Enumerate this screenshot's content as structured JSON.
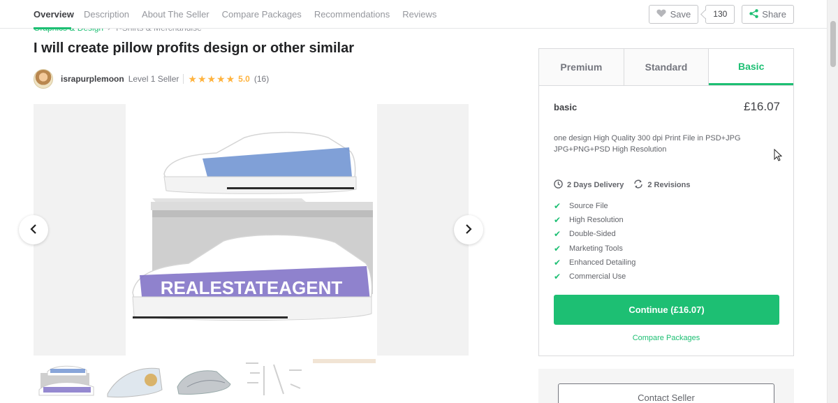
{
  "nav": {
    "tabs": [
      {
        "label": "Overview"
      },
      {
        "label": "Description"
      },
      {
        "label": "About The Seller"
      },
      {
        "label": "Compare Packages"
      },
      {
        "label": "Recommendations"
      },
      {
        "label": "Reviews"
      }
    ],
    "save_label": "Save",
    "save_count": "130",
    "share_label": "Share"
  },
  "breadcrumb": {
    "crumb1": "Graphics & Design",
    "crumb2": "T-Shirts & Merchandise"
  },
  "gig": {
    "title": "I will create pillow profits design or other similar"
  },
  "seller": {
    "name": "israpurplemoon",
    "level": "Level 1 Seller",
    "stars": "★★★★★",
    "rating": "5.0",
    "reviews": "(16)"
  },
  "product_art": {
    "text": "REALESTATEAGENT"
  },
  "package": {
    "tabs": [
      {
        "label": "Premium"
      },
      {
        "label": "Standard"
      },
      {
        "label": "Basic"
      }
    ],
    "name": "basic",
    "price": "£16.07",
    "description": "one design High Quality 300 dpi Print File in PSD+JPG JPG+PNG+PSD High Resolution",
    "delivery": "2 Days Delivery",
    "revisions": "2 Revisions",
    "features": [
      {
        "label": "Source File"
      },
      {
        "label": "High Resolution"
      },
      {
        "label": "Double-Sided"
      },
      {
        "label": "Marketing Tools"
      },
      {
        "label": "Enhanced Detailing"
      },
      {
        "label": "Commercial Use"
      }
    ],
    "continue_label": "Continue (£16.07)",
    "compare_label": "Compare Packages"
  },
  "contact": {
    "label": "Contact Seller"
  },
  "colors": {
    "accent": "#1dbf73",
    "star": "#ffb33e",
    "text": "#404145"
  }
}
